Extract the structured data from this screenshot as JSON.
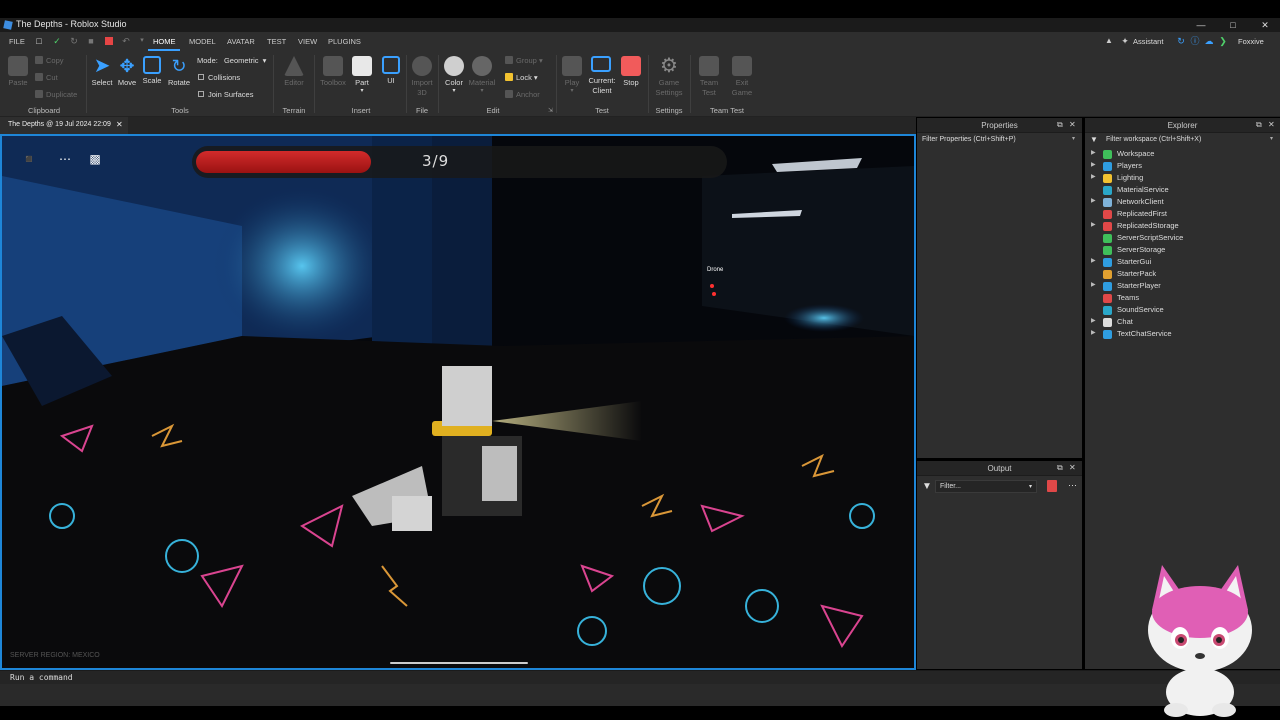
{
  "window": {
    "title": "The Depths - Roblox Studio"
  },
  "menu": {
    "file": "FILE",
    "tabs": [
      "HOME",
      "MODEL",
      "AVATAR",
      "TEST",
      "VIEW",
      "PLUGINS"
    ],
    "active_tab": "HOME",
    "assistant": "Assistant",
    "user": "Foxxive"
  },
  "ribbon": {
    "clipboard": {
      "paste": "Paste",
      "copy": "Copy",
      "cut": "Cut",
      "duplicate": "Duplicate",
      "label": "Clipboard"
    },
    "tools": {
      "select": "Select",
      "move": "Move",
      "scale": "Scale",
      "rotate": "Rotate",
      "mode_label": "Mode:",
      "mode_value": "Geometric",
      "collisions": "Collisions",
      "join_surfaces": "Join Surfaces",
      "label": "Tools"
    },
    "terrain": {
      "editor": "Editor",
      "label": "Terrain"
    },
    "insert": {
      "toolbox": "Toolbox",
      "part": "Part",
      "ui": "UI",
      "label": "Insert"
    },
    "file": {
      "import3d": "Import 3D",
      "label": "File"
    },
    "edit": {
      "color": "Color",
      "material": "Material",
      "group": "Group",
      "lock": "Lock",
      "anchor": "Anchor",
      "label": "Edit"
    },
    "test": {
      "play": "Play",
      "current_client": "Current: Client",
      "stop": "Stop",
      "label": "Test"
    },
    "settings": {
      "game_settings": "Game Settings",
      "label": "Settings"
    },
    "team_test": {
      "team_test": "Team Test",
      "exit_game": "Exit Game",
      "label": "Team Test"
    }
  },
  "document": {
    "tab_label": "The Depths @ 19 Jul 2024 22:09"
  },
  "game_hud": {
    "progress_text": "3/9",
    "progress_fraction": 0.333,
    "drone_label": "Drone",
    "server_region": "SERVER REGION: MEXICO"
  },
  "properties": {
    "title": "Properties",
    "filter_placeholder": "Filter Properties (Ctrl+Shift+P)"
  },
  "explorer": {
    "title": "Explorer",
    "filter_placeholder": "Filter workspace (Ctrl+Shift+X)",
    "items": [
      {
        "label": "Workspace",
        "expandable": true,
        "color": "#3fbf5a"
      },
      {
        "label": "Players",
        "expandable": true,
        "color": "#2f9de0"
      },
      {
        "label": "Lighting",
        "expandable": true,
        "color": "#f2c230"
      },
      {
        "label": "MaterialService",
        "expandable": false,
        "color": "#2aa7c9"
      },
      {
        "label": "NetworkClient",
        "expandable": true,
        "color": "#7fb3d9"
      },
      {
        "label": "ReplicatedFirst",
        "expandable": false,
        "color": "#e04848"
      },
      {
        "label": "ReplicatedStorage",
        "expandable": true,
        "color": "#e04848"
      },
      {
        "label": "ServerScriptService",
        "expandable": false,
        "color": "#3fbf5a"
      },
      {
        "label": "ServerStorage",
        "expandable": false,
        "color": "#3fbf5a"
      },
      {
        "label": "StarterGui",
        "expandable": true,
        "color": "#2f9de0"
      },
      {
        "label": "StarterPack",
        "expandable": false,
        "color": "#e0a030"
      },
      {
        "label": "StarterPlayer",
        "expandable": true,
        "color": "#2f9de0"
      },
      {
        "label": "Teams",
        "expandable": false,
        "color": "#e04848"
      },
      {
        "label": "SoundService",
        "expandable": false,
        "color": "#2aa7c9"
      },
      {
        "label": "Chat",
        "expandable": true,
        "color": "#dddddd"
      },
      {
        "label": "TextChatService",
        "expandable": true,
        "color": "#2f9de0"
      }
    ]
  },
  "output": {
    "title": "Output",
    "filter_placeholder": "Filter..."
  },
  "command_bar": {
    "placeholder": "Run a command"
  }
}
